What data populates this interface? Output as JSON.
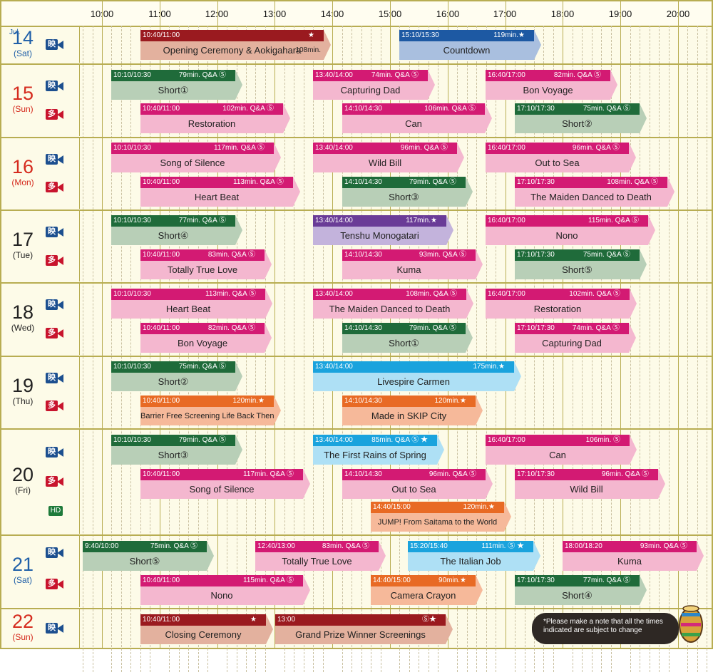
{
  "header": {
    "hours": [
      "10:00",
      "11:00",
      "12:00",
      "13:00",
      "14:00",
      "15:00",
      "16:00",
      "17:00",
      "18:00",
      "19:00",
      "20:00"
    ]
  },
  "month_label": "Jul.",
  "days": [
    {
      "num": "14",
      "weekday": "(Sat)",
      "color": "blue",
      "badges": [
        "映"
      ]
    },
    {
      "num": "15",
      "weekday": "(Sun)",
      "color": "red",
      "badges": [
        "映",
        "多"
      ]
    },
    {
      "num": "16",
      "weekday": "(Mon)",
      "color": "red",
      "badges": [
        "映",
        "多"
      ]
    },
    {
      "num": "17",
      "weekday": "(Tue)",
      "color": "black",
      "badges": [
        "映",
        "多"
      ]
    },
    {
      "num": "18",
      "weekday": "(Wed)",
      "color": "black",
      "badges": [
        "映",
        "多"
      ]
    },
    {
      "num": "19",
      "weekday": "(Thu)",
      "color": "black",
      "badges": [
        "映",
        "多"
      ]
    },
    {
      "num": "20",
      "weekday": "(Fri)",
      "color": "black",
      "badges": [
        "映",
        "多",
        "HD"
      ]
    },
    {
      "num": "21",
      "weekday": "(Sat)",
      "color": "blue",
      "badges": [
        "映",
        "多"
      ]
    },
    {
      "num": "22",
      "weekday": "(Sun)",
      "color": "red",
      "badges": [
        "映"
      ]
    }
  ],
  "events": [
    {
      "time": "10:40/11:00",
      "note": "★",
      "title": "Opening Ceremony & Aokigahara",
      "sub": "108min.",
      "color": "darkred"
    },
    {
      "time": "15:10/15:30",
      "note": "119min.★",
      "title": "Countdown",
      "color": "navy"
    },
    {
      "time": "10:10/10:30",
      "note": "79min. Q&A Ⓢ",
      "title": "Short①",
      "color": "green"
    },
    {
      "time": "13:40/14:00",
      "note": "74min. Q&A Ⓢ",
      "title": "Capturing Dad",
      "color": "pink"
    },
    {
      "time": "16:40/17:00",
      "note": "82min. Q&A Ⓢ",
      "title": "Bon Voyage",
      "color": "pink"
    },
    {
      "time": "10:40/11:00",
      "note": "102min. Q&A Ⓢ",
      "title": "Restoration",
      "color": "pink"
    },
    {
      "time": "14:10/14:30",
      "note": "106min. Q&A Ⓢ",
      "title": "Can",
      "color": "pink"
    },
    {
      "time": "17:10/17:30",
      "note": "75min. Q&A Ⓢ",
      "title": "Short②",
      "color": "green"
    },
    {
      "time": "10:10/10:30",
      "note": "117min. Q&A Ⓢ",
      "title": "Song of Silence",
      "color": "pink"
    },
    {
      "time": "13:40/14:00",
      "note": "96min. Q&A Ⓢ",
      "title": "Wild Bill",
      "color": "pink"
    },
    {
      "time": "16:40/17:00",
      "note": "96min. Q&A Ⓢ",
      "title": "Out to Sea",
      "color": "pink"
    },
    {
      "time": "10:40/11:00",
      "note": "113min. Q&A Ⓢ",
      "title": "Heart Beat",
      "color": "pink"
    },
    {
      "time": "14:10/14:30",
      "note": "79min. Q&A Ⓢ",
      "title": "Short③",
      "color": "green"
    },
    {
      "time": "17:10/17:30",
      "note": "108min. Q&A Ⓢ",
      "title": "The Maiden Danced to Death",
      "color": "pink"
    },
    {
      "time": "10:10/10:30",
      "note": "77min. Q&A Ⓢ",
      "title": "Short④",
      "color": "green"
    },
    {
      "time": "13:40/14:00",
      "note": "117min.★",
      "title": "Tenshu Monogatari",
      "color": "purple"
    },
    {
      "time": "16:40/17:00",
      "note": "115min. Q&A Ⓢ",
      "title": "Nono",
      "color": "pink"
    },
    {
      "time": "10:40/11:00",
      "note": "83min. Q&A Ⓢ",
      "title": "Totally True Love",
      "color": "pink"
    },
    {
      "time": "14:10/14:30",
      "note": "93min. Q&A Ⓢ",
      "title": "Kuma",
      "color": "pink"
    },
    {
      "time": "17:10/17:30",
      "note": "75min. Q&A Ⓢ",
      "title": "Short⑤",
      "color": "green"
    },
    {
      "time": "10:10/10:30",
      "note": "113min. Q&A Ⓢ",
      "title": "Heart Beat",
      "color": "pink"
    },
    {
      "time": "13:40/14:00",
      "note": "108min. Q&A Ⓢ",
      "title": "The Maiden Danced to Death",
      "color": "pink"
    },
    {
      "time": "16:40/17:00",
      "note": "102min. Q&A Ⓢ",
      "title": "Restoration",
      "color": "pink"
    },
    {
      "time": "10:40/11:00",
      "note": "82min. Q&A Ⓢ",
      "title": "Bon Voyage",
      "color": "pink"
    },
    {
      "time": "14:10/14:30",
      "note": "79min. Q&A Ⓢ",
      "title": "Short①",
      "color": "green"
    },
    {
      "time": "17:10/17:30",
      "note": "74min. Q&A Ⓢ",
      "title": "Capturing Dad",
      "color": "pink"
    },
    {
      "time": "10:10/10:30",
      "note": "75min. Q&A Ⓢ",
      "title": "Short②",
      "color": "green"
    },
    {
      "time": "13:40/14:00",
      "note": "175min.★",
      "title": "Livespire Carmen",
      "color": "cyan"
    },
    {
      "time": "10:40/11:00",
      "note": "120min.★",
      "title": "Barrier Free Screening Life Back Then",
      "color": "orange"
    },
    {
      "time": "14:10/14:30",
      "note": "120min.★",
      "title": "Made in SKIP City",
      "color": "orange"
    },
    {
      "time": "10:10/10:30",
      "note": "79min. Q&A Ⓢ",
      "title": "Short③",
      "color": "green"
    },
    {
      "time": "13:40/14:00",
      "note": "85min. Q&A Ⓢ ★",
      "title": "The First Rains of Spring",
      "color": "cyan"
    },
    {
      "time": "16:40/17:00",
      "note": "106min. Ⓢ",
      "title": "Can",
      "color": "pink"
    },
    {
      "time": "10:40/11:00",
      "note": "117min. Q&A Ⓢ",
      "title": "Song of Silence",
      "color": "pink"
    },
    {
      "time": "14:10/14:30",
      "note": "96min. Q&A Ⓢ",
      "title": "Out to Sea",
      "color": "pink"
    },
    {
      "time": "17:10/17:30",
      "note": "96min. Q&A Ⓢ",
      "title": "Wild Bill",
      "color": "pink"
    },
    {
      "time": "14:40/15:00",
      "note": "120min.★",
      "title": "JUMP! From Saitama to the World",
      "color": "orange"
    },
    {
      "time": "9:40/10:00",
      "note": "75min. Q&A Ⓢ",
      "title": "Short⑤",
      "color": "green"
    },
    {
      "time": "12:40/13:00",
      "note": "83min. Q&A Ⓢ",
      "title": "Totally True Love",
      "color": "pink"
    },
    {
      "time": "15:20/15:40",
      "note": "111min. Ⓢ ★",
      "title": "The Italian Job",
      "color": "cyan"
    },
    {
      "time": "18:00/18:20",
      "note": "93min. Q&A Ⓢ",
      "title": "Kuma",
      "color": "pink"
    },
    {
      "time": "10:40/11:00",
      "note": "115min. Q&A Ⓢ",
      "title": "Nono",
      "color": "pink"
    },
    {
      "time": "14:40/15:00",
      "note": "90min.★",
      "title": "Camera Crayon",
      "color": "orange"
    },
    {
      "time": "17:10/17:30",
      "note": "77min. Q&A Ⓢ",
      "title": "Short④",
      "color": "green"
    },
    {
      "time": "10:40/11:00",
      "note": "★",
      "title": "Closing Ceremony",
      "color": "darkred"
    },
    {
      "time": "13:00",
      "note": "Ⓢ★",
      "title": "Grand Prize Winner Screenings",
      "color": "darkred"
    }
  ],
  "footer_note": "*Please make a note that all the times indicated are subject to change"
}
